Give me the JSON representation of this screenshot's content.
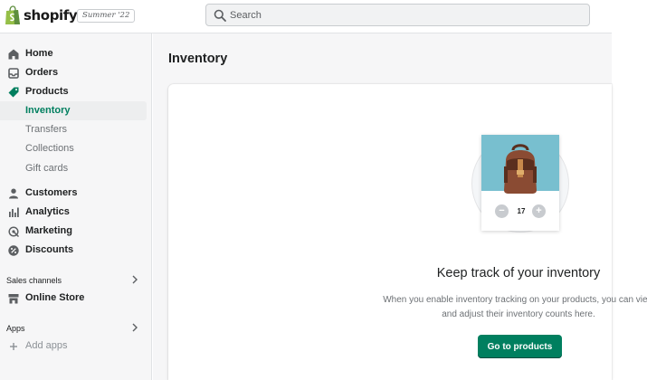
{
  "brand": {
    "name": "shopify",
    "edition": "Summer '22"
  },
  "search": {
    "placeholder": "Search"
  },
  "sidebar": {
    "items": [
      {
        "label": "Home",
        "icon": "home-icon"
      },
      {
        "label": "Orders",
        "icon": "inbox-icon"
      },
      {
        "label": "Products",
        "icon": "tag-icon"
      },
      {
        "label": "Inventory",
        "sub": true,
        "active": true
      },
      {
        "label": "Transfers",
        "sub": true
      },
      {
        "label": "Collections",
        "sub": true
      },
      {
        "label": "Gift cards",
        "sub": true
      },
      {
        "label": "Customers",
        "icon": "person-icon"
      },
      {
        "label": "Analytics",
        "icon": "bar-chart-icon"
      },
      {
        "label": "Marketing",
        "icon": "megaphone-icon"
      },
      {
        "label": "Discounts",
        "icon": "discount-icon"
      }
    ],
    "sales_channels_header": "Sales channels",
    "online_store": "Online Store",
    "apps_header": "Apps",
    "add_apps": "Add apps"
  },
  "page": {
    "title": "Inventory"
  },
  "empty_state": {
    "quantity": "17",
    "title": "Keep track of your inventory",
    "description": "When you enable inventory tracking on your products, you can view and adjust their inventory counts here.",
    "button": "Go to products"
  },
  "colors": {
    "accent": "#007f5f",
    "active_text": "#007f5f",
    "sidebar_bg": "#f6f6f7",
    "illustration_sky": "#78bfcf",
    "backpack": "#8a4b33"
  }
}
